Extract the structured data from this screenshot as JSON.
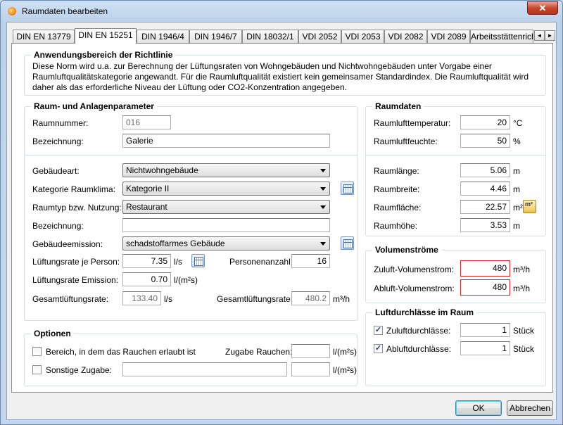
{
  "window": {
    "title": "Raumdaten bearbeiten",
    "close_glyph": "✕"
  },
  "tabs": [
    {
      "label": "DIN EN 13779"
    },
    {
      "label": "DIN EN 15251",
      "active": true
    },
    {
      "label": "DIN 1946/4"
    },
    {
      "label": "DIN 1946/7"
    },
    {
      "label": "DIN 18032/1"
    },
    {
      "label": "VDI 2052"
    },
    {
      "label": "VDI 2053"
    },
    {
      "label": "VDI 2082"
    },
    {
      "label": "VDI 2089"
    },
    {
      "label": "Arbeitsstättenricht"
    }
  ],
  "tab_scroll": {
    "left": "◄",
    "right": "►"
  },
  "scope": {
    "title": "Anwendungsbereich der Richtlinie",
    "text": "Diese  Norm wird u.a. zur Berechnung der Lüftungsraten von Wohngebäuden und Nichtwohngebäuden unter Vorgabe einer Raumluftqualitätskategorie angewandt. Für die Raumluftqualität existiert kein gemeinsamer Standardindex. Die Raumluftqualität wird daher als das erforderliche Niveau der Lüftung oder CO2-Konzentration angegeben."
  },
  "params": {
    "title": "Raum- und Anlagenparameter",
    "room_number": {
      "label": "Raumnummer:",
      "value": "016"
    },
    "designation": {
      "label": "Bezeichnung:",
      "value": "Galerie"
    },
    "building_type": {
      "label": "Gebäudeart:",
      "value": "Nichtwohngebäude"
    },
    "climate_category": {
      "label": "Kategorie Raumklima:",
      "value": "Kategorie II"
    },
    "room_type": {
      "label": "Raumtyp bzw. Nutzung:",
      "value": "Restaurant"
    },
    "designation2": {
      "label": "Bezeichnung:",
      "value": ""
    },
    "emission": {
      "label": "Gebäudeemission:",
      "value": "schadstoffarmes Gebäude"
    },
    "rate_person": {
      "label": "Lüftungsrate je Person:",
      "value": "7.35",
      "unit": "l/s"
    },
    "persons": {
      "label": "Personenanzahl:",
      "value": "16"
    },
    "rate_emission": {
      "label": "Lüftungsrate Emission:",
      "value": "0.70",
      "unit": "l/(m²s)"
    },
    "total_rate": {
      "label": "Gesamtlüftungsrate:",
      "value": "133.40",
      "unit": "l/s"
    },
    "total_rate2": {
      "label": "Gesamtlüftungsrate:",
      "value": "480.2",
      "unit": "m³/h"
    }
  },
  "options": {
    "title": "Optionen",
    "smoking": {
      "label": "Bereich, in dem das Rauchen erlaubt ist",
      "checked": false
    },
    "smoking_extra": {
      "label": "Zugabe Rauchen:",
      "value": "",
      "unit": "l/(m²s)"
    },
    "other": {
      "label": "Sonstige Zugabe:",
      "text": "",
      "value": "",
      "unit": "l/(m²s)"
    }
  },
  "room": {
    "title": "Raumdaten",
    "temp": {
      "label": "Raumlufttemperatur:",
      "value": "20",
      "unit": "°C"
    },
    "humidity": {
      "label": "Raumluftfeuchte:",
      "value": "50",
      "unit": "%"
    },
    "length": {
      "label": "Raumlänge:",
      "value": "5.06",
      "unit": "m"
    },
    "width": {
      "label": "Raumbreite:",
      "value": "4.46",
      "unit": "m"
    },
    "area": {
      "label": "Raumfläche:",
      "value": "22.57",
      "unit": "m²",
      "button_glyph": "m²"
    },
    "height": {
      "label": "Raumhöhe:",
      "value": "3.53",
      "unit": "m"
    }
  },
  "volume": {
    "title": "Volumenströme",
    "supply": {
      "label": "Zuluft-Volumenstrom:",
      "value": "480",
      "unit": "m³/h"
    },
    "exhaust": {
      "label": "Abluft-Volumenstrom:",
      "value": "480",
      "unit": "m³/h"
    }
  },
  "outlets": {
    "title": "Luftdurchlässe im Raum",
    "supply": {
      "label": "Zuluftdurchlässe:",
      "value": "1",
      "unit": "Stück",
      "checked": true
    },
    "exhaust": {
      "label": "Abluftdurchlässe:",
      "value": "1",
      "unit": "Stück",
      "checked": true
    }
  },
  "check_glyph": "✓",
  "buttons": {
    "ok": "OK",
    "cancel": "Abbrechen"
  }
}
